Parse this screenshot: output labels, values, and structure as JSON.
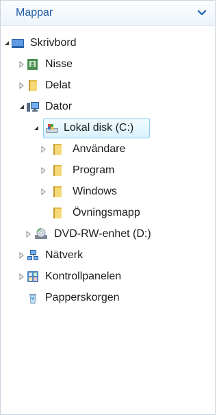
{
  "header": {
    "title": "Mappar"
  },
  "tree": {
    "items": [
      {
        "label": "Skrivbord",
        "icon": "desktop-icon",
        "expanded": true
      },
      {
        "label": "Nisse",
        "icon": "user-folder-icon",
        "expanded": false
      },
      {
        "label": "Delat",
        "icon": "folder-icon",
        "expanded": false
      },
      {
        "label": "Dator",
        "icon": "computer-icon",
        "expanded": true
      },
      {
        "label": "Lokal disk (C:)",
        "icon": "local-disk-icon",
        "expanded": true,
        "selected": true
      },
      {
        "label": "Användare",
        "icon": "folder-icon",
        "expanded": false
      },
      {
        "label": "Program",
        "icon": "folder-icon",
        "expanded": false
      },
      {
        "label": "Windows",
        "icon": "folder-icon",
        "expanded": false
      },
      {
        "label": "Övningsmapp",
        "icon": "folder-icon"
      },
      {
        "label": "DVD-RW-enhet (D:)",
        "icon": "dvd-drive-icon",
        "expanded": false
      },
      {
        "label": "Nätverk",
        "icon": "network-icon",
        "expanded": false
      },
      {
        "label": "Kontrollpanelen",
        "icon": "control-panel-icon",
        "expanded": false
      },
      {
        "label": "Papperskorgen",
        "icon": "recycle-bin-icon"
      }
    ]
  },
  "colors": {
    "header_text": "#1f5da8",
    "selection_border": "#8ccdf2",
    "selection_fill": "#d9f1fd"
  }
}
